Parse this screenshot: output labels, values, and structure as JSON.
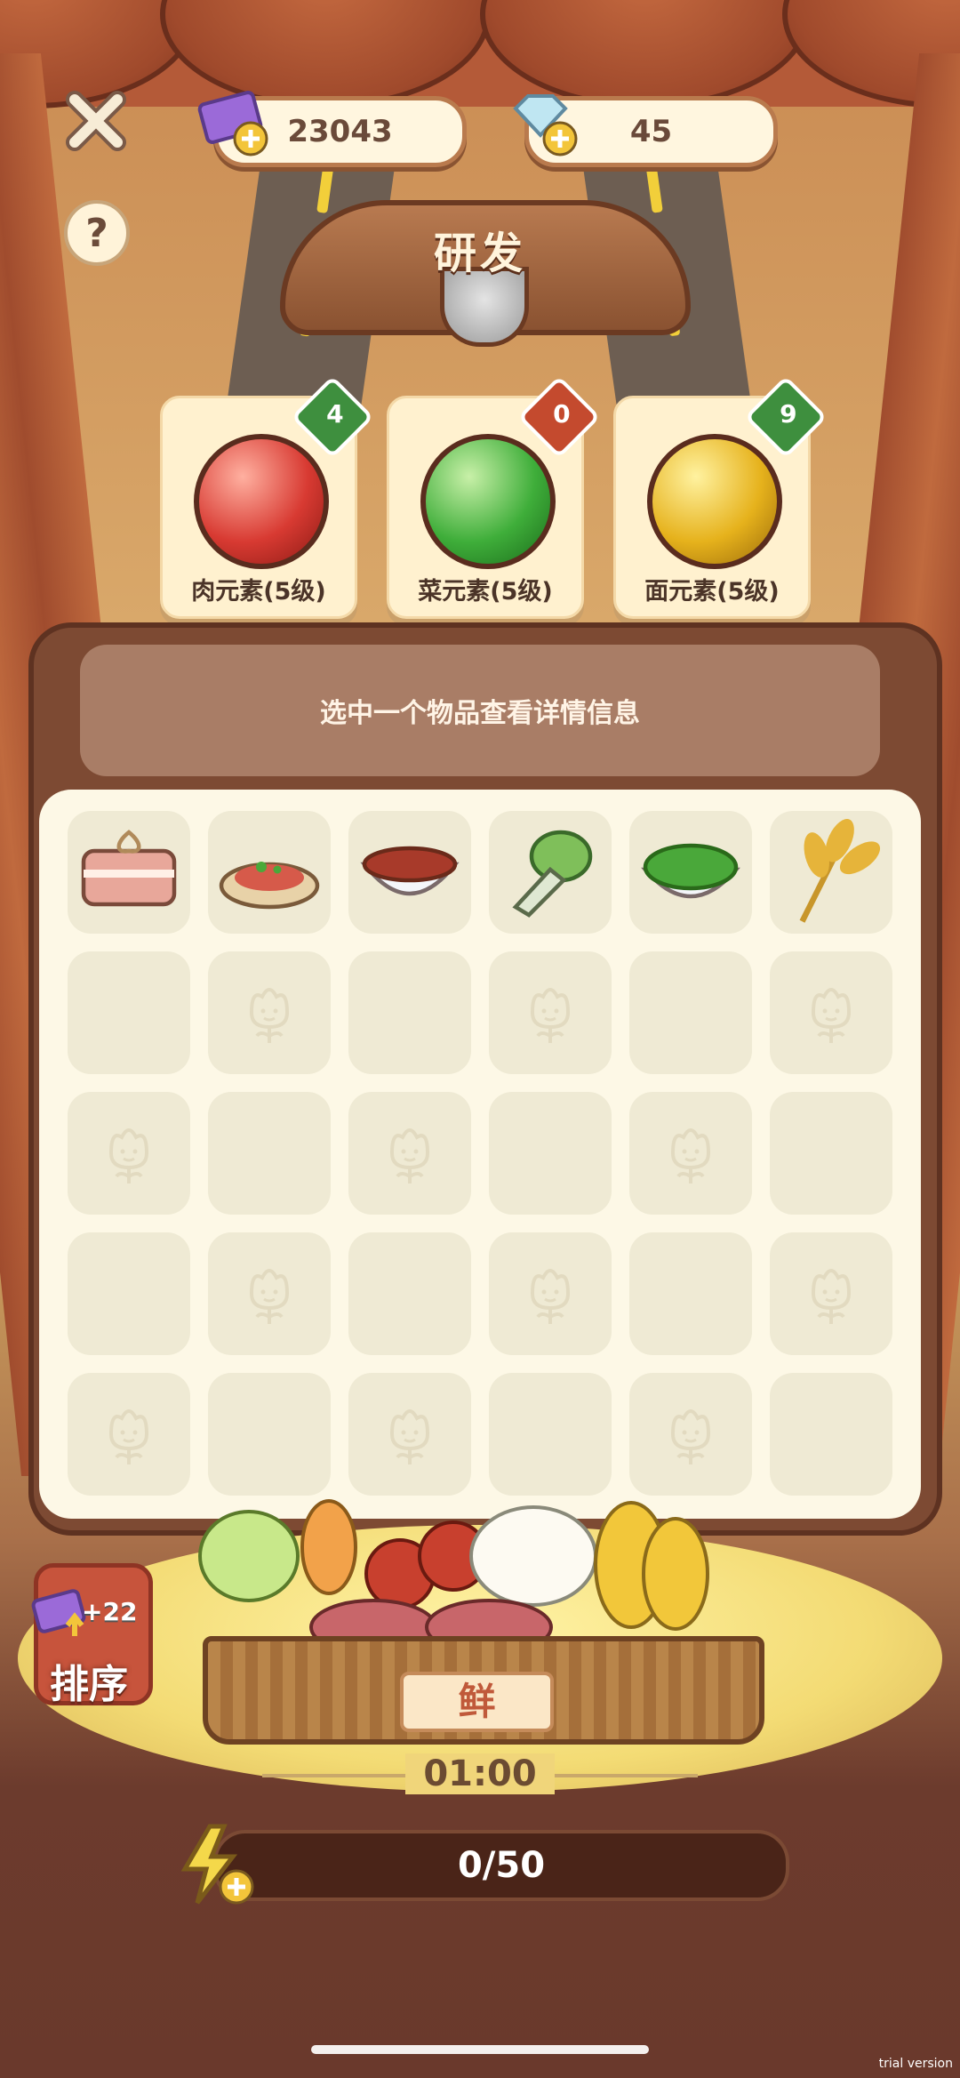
{
  "currency": {
    "tickets": "23043",
    "gems": "45"
  },
  "icons": {
    "close": "close-icon",
    "help": "?"
  },
  "title": "研发",
  "elements": [
    {
      "label": "肉元素(5级)",
      "count": "4",
      "orb_color": "#d83a32",
      "badge_color": "#3e8f3e"
    },
    {
      "label": "菜元素(5级)",
      "count": "0",
      "orb_color": "#3fae3a",
      "badge_color": "#c44a2e"
    },
    {
      "label": "面元素(5级)",
      "count": "9",
      "orb_color": "#e6b21c",
      "badge_color": "#3e8f3e"
    }
  ],
  "info": {
    "hint": "选中一个物品查看详情信息"
  },
  "items": [
    {
      "name": "pork-belly",
      "color": "#e8a79a"
    },
    {
      "name": "stir-fried-meat",
      "color": "#d65a4a"
    },
    {
      "name": "minced-meat-bowl",
      "color": "#a83a2a"
    },
    {
      "name": "bok-choy",
      "color": "#7fbf5a"
    },
    {
      "name": "green-veg-bowl",
      "color": "#4aa83a"
    },
    {
      "name": "wheat",
      "color": "#e6b43a"
    }
  ],
  "grid": {
    "rows": 5,
    "cols": 6
  },
  "basket": {
    "tag": "鲜",
    "timer": "01:00"
  },
  "sort": {
    "label": "排序",
    "bonus": "+22"
  },
  "energy": {
    "progress": "0/50",
    "current": 0,
    "max": 50
  },
  "watermark": "trial version"
}
